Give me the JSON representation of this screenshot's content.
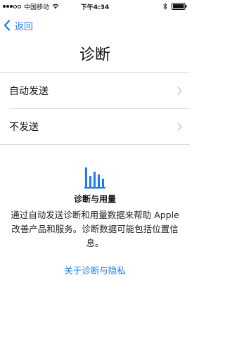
{
  "status_bar": {
    "carrier": "中国移动",
    "time": "下午4:34"
  },
  "nav": {
    "back_label": "返回"
  },
  "page": {
    "title": "诊断"
  },
  "options": [
    {
      "label": "自动发送"
    },
    {
      "label": "不发送"
    }
  ],
  "info": {
    "heading": "诊断与用量",
    "body": "通过自动发送诊断和用量数据来帮助 Apple 改善产品和服务。诊断数据可能包括位置信息。",
    "link": "关于诊断与隐私"
  },
  "colors": {
    "accent": "#1a7cf5",
    "separator": "#d9d9d9",
    "chevron": "#c7c7cc"
  }
}
